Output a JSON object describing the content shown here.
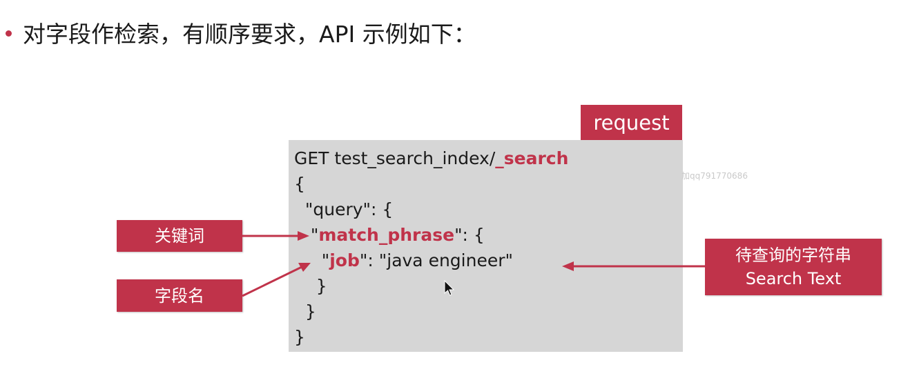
{
  "slide": {
    "heading": "对字段作检索，有顺序要求，API 示例如下："
  },
  "request_tab": {
    "label": "request"
  },
  "code": {
    "line1_prefix": "GET test_search_index/",
    "line1_endpoint": "_search",
    "line2": "{",
    "line3": "  \"query\": {",
    "line4_indent": "   \"",
    "line4_key": "match_phrase",
    "line4_suffix": "\": {",
    "line5_indent": "     \"",
    "line5_key": "job",
    "line5_suffix": "\": \"java engineer\"",
    "line6": "    }",
    "line7": "  }",
    "line8": "}"
  },
  "annotations": {
    "keyword_label": "关键词",
    "field_label": "字段名",
    "search_text_line1": "待查询的字符串",
    "search_text_line2": "Search Text"
  },
  "watermark": {
    "text": "加qq791770686"
  },
  "colors": {
    "accent": "#c0334a",
    "code_background": "#d6d6d6",
    "text": "#1a1a1a"
  },
  "icons": {
    "bullet": "bullet-dot",
    "cursor": "mouse-pointer-icon"
  }
}
